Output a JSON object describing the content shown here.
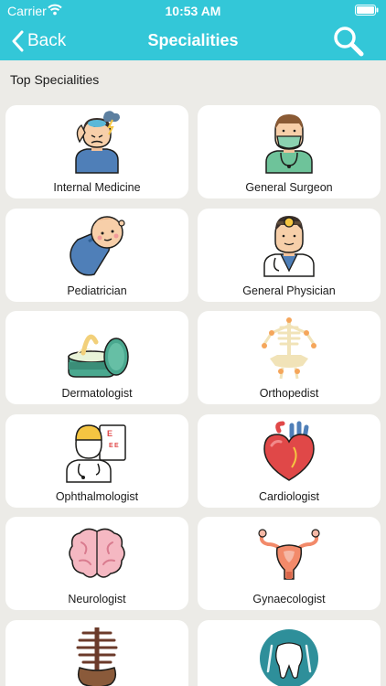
{
  "status": {
    "carrier": "Carrier",
    "time": "10:53 AM"
  },
  "nav": {
    "back_label": "Back",
    "title": "Specialities"
  },
  "section": {
    "title": "Top Specialities"
  },
  "specialities": [
    {
      "label": "Internal Medicine",
      "icon": "sick-patient-icon"
    },
    {
      "label": "General Surgeon",
      "icon": "surgeon-icon"
    },
    {
      "label": "Pediatrician",
      "icon": "baby-icon"
    },
    {
      "label": "General Physician",
      "icon": "physician-icon"
    },
    {
      "label": "Dermatologist",
      "icon": "cream-jar-icon"
    },
    {
      "label": "Orthopedist",
      "icon": "skeleton-icon"
    },
    {
      "label": "Ophthalmologist",
      "icon": "eye-chart-doctor-icon"
    },
    {
      "label": "Cardiologist",
      "icon": "heart-icon"
    },
    {
      "label": "Neurologist",
      "icon": "brain-icon"
    },
    {
      "label": "Gynaecologist",
      "icon": "uterus-icon"
    },
    {
      "label": "",
      "icon": "spine-pelvis-icon"
    },
    {
      "label": "",
      "icon": "tooth-icon"
    }
  ],
  "colors": {
    "header": "#33c7d8",
    "background": "#ecebe7",
    "card": "#ffffff"
  }
}
